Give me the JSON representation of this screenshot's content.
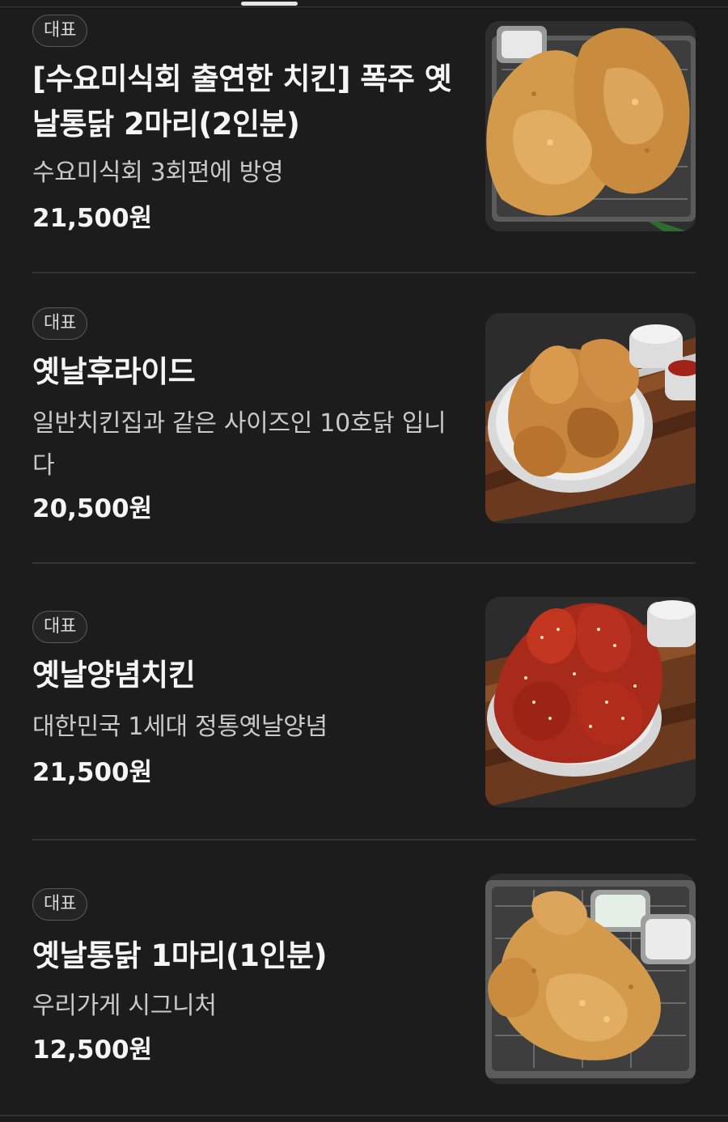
{
  "menu": {
    "items": [
      {
        "badge": "대표",
        "name": "[수요미식회 출연한 치킨] 폭주 옛날통닭 2마리(2인분)",
        "description": "수요미식회 3회편에 방영",
        "price": "21,500원",
        "image": "fried-whole-chicken-tray-photo"
      },
      {
        "badge": "대표",
        "name": "옛날후라이드",
        "description": "일반치킨집과 같은 사이즈인 10호닭 입니다",
        "price": "20,500원",
        "image": "fried-chicken-plate-photo"
      },
      {
        "badge": "대표",
        "name": "옛날양념치킨",
        "description": "대한민국 1세대 정통옛날양념",
        "price": "21,500원",
        "image": "seasoned-chicken-plate-photo"
      },
      {
        "badge": "대표",
        "name": "옛날통닭 1마리(1인분)",
        "description": "우리가게 시그니처",
        "price": "12,500원",
        "image": "single-whole-chicken-tray-photo"
      }
    ]
  },
  "colors": {
    "background": "#1c1c1c",
    "text_primary": "#f5f5f5",
    "text_secondary": "#c9c9c9",
    "divider": "#333333",
    "badge_border": "#5a5a5a"
  }
}
